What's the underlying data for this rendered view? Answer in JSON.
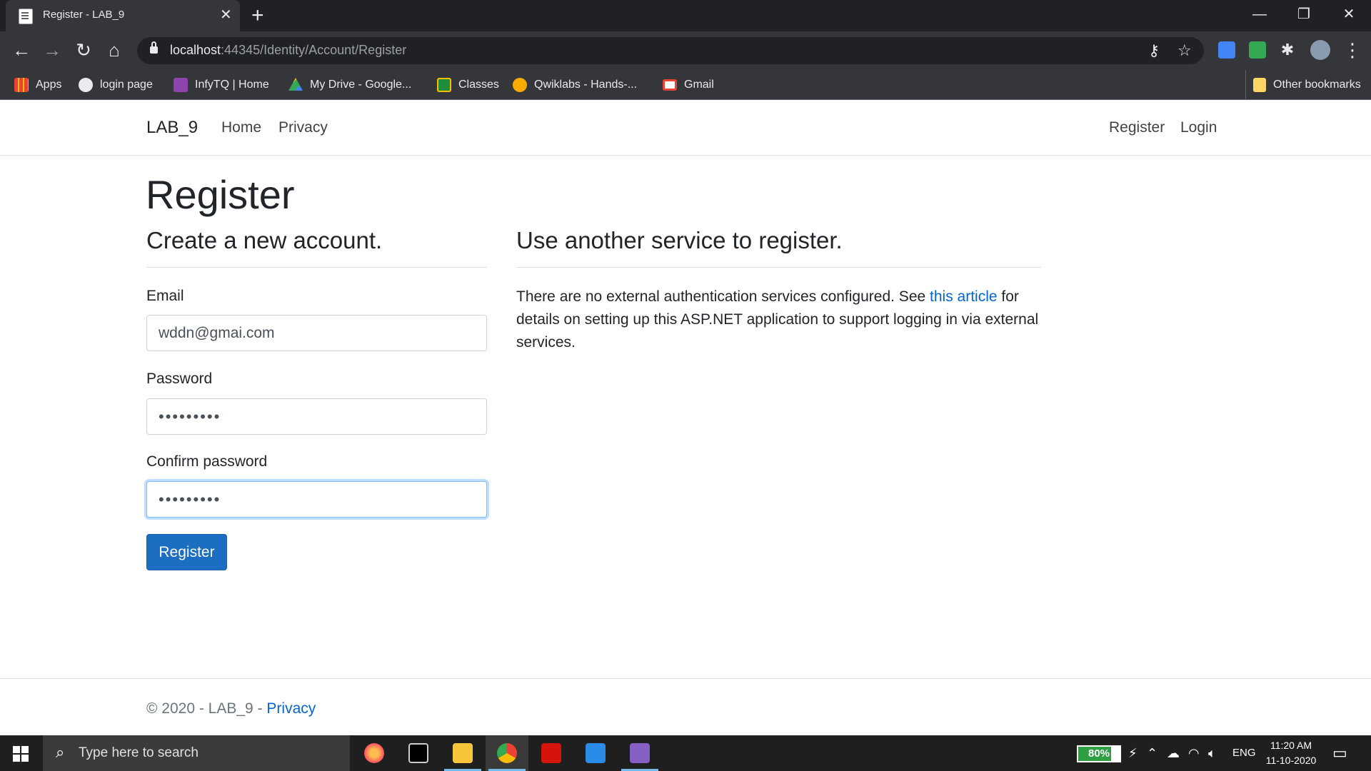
{
  "browser": {
    "tab_title": "Register - LAB_9",
    "tab_close": "✕",
    "new_tab": "+",
    "url_host": "localhost",
    "url_path": ":44345/Identity/Account/Register",
    "bookmarks": [
      {
        "label": "Apps",
        "icon": "apps-grid-icon",
        "color": "#ea4335"
      },
      {
        "label": "login page",
        "icon": "globe-icon",
        "color": "#e8eaed"
      },
      {
        "label": "InfyTQ | Home",
        "icon": "infytq-icon",
        "color": "#8e44ad"
      },
      {
        "label": "My Drive - Google...",
        "icon": "google-drive-icon",
        "color": "#fbbc04"
      },
      {
        "label": "Classes",
        "icon": "google-classroom-icon",
        "color": "#1e8e3e"
      },
      {
        "label": "Qwiklabs - Hands-...",
        "icon": "qwiklabs-icon",
        "color": "#f9ab00"
      },
      {
        "label": "Gmail",
        "icon": "gmail-icon",
        "color": "#ea4335"
      }
    ],
    "other_bookmarks": "Other bookmarks"
  },
  "navbar": {
    "brand": "LAB_9",
    "links": [
      "Home",
      "Privacy"
    ],
    "right_links": [
      "Register",
      "Login"
    ]
  },
  "page": {
    "title": "Register",
    "form_heading": "Create a new account.",
    "email_label": "Email",
    "email_value": "wddn@gmai.com",
    "password_label": "Password",
    "password_value": "•••••••••",
    "confirm_label": "Confirm password",
    "confirm_value": "•••••••••",
    "submit_label": "Register",
    "external_heading": "Use another service to register.",
    "external_text_before": "There are no external authentication services configured. See ",
    "external_link": "this article",
    "external_text_after": " for details on setting up this ASP.NET application to support logging in via external services."
  },
  "footer": {
    "text": "© 2020 - LAB_9 - ",
    "privacy_link": "Privacy"
  },
  "taskbar": {
    "search_placeholder": "Type here to search",
    "battery_percent": 80,
    "battery_label": "80%",
    "language": "ENG",
    "time": "11:20 AM",
    "date": "11-10-2020"
  },
  "colors": {
    "primary": "#1b6ec2",
    "link": "#0366d6"
  }
}
